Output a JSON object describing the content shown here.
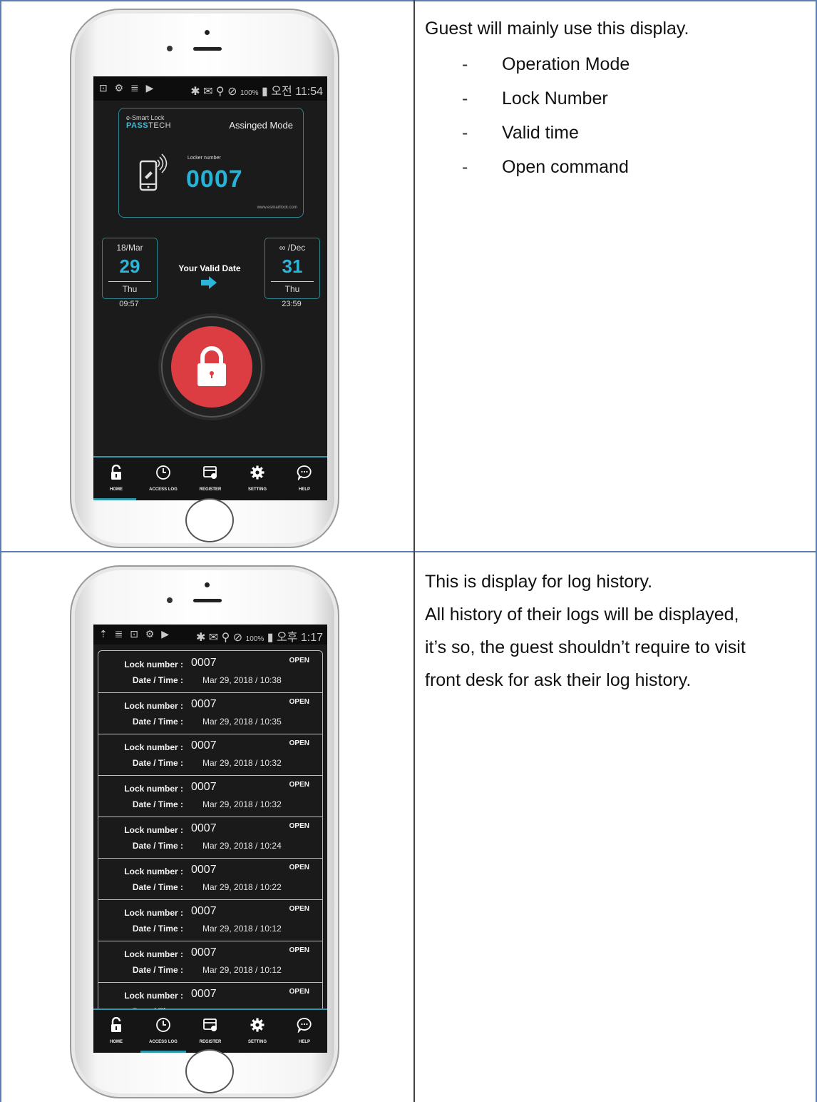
{
  "home_screen": {
    "status_bar": {
      "left_icons": "⊡ ⚙ ≣ ▶",
      "right_icons": "✱ ✉ ⚲ ⊘",
      "battery_pct": "100%",
      "time": "오전 11:54"
    },
    "brand_small": "e-Smart Lock",
    "brand_pass": "PASS",
    "brand_tech": "TECH",
    "mode": "Assinged Mode",
    "locker_label": "Locker number",
    "locker_number": "0007",
    "url": "www.esmartlock.com",
    "valid_label": "Your Valid Date",
    "start": {
      "month": "18/Mar",
      "day": "29",
      "weekday": "Thu",
      "time": "09:57"
    },
    "end": {
      "month": "∞ /Dec",
      "day": "31",
      "weekday": "Thu",
      "time": "23:59"
    }
  },
  "nav": {
    "home": "HOME",
    "access_log": "ACCESS LOG",
    "register": "REGISTER",
    "setting": "SETTING",
    "help": "HELP"
  },
  "desc1": {
    "intro": "Guest will mainly use this display.",
    "dash": "-",
    "items": [
      "Operation Mode",
      "Lock Number",
      "Valid time",
      "Open command"
    ]
  },
  "log_screen": {
    "status_bar": {
      "left_icons": "⇡ ≣ ⊡ ⚙ ▶",
      "right_icons": "✱ ✉ ⚲ ⊘",
      "battery_pct": "100%",
      "time": "오후 1:17"
    },
    "lock_label": "Lock number :",
    "date_label": "Date / Time :",
    "entries": [
      {
        "number": "0007",
        "datetime": "Mar 29, 2018 / 10:38",
        "status": "OPEN"
      },
      {
        "number": "0007",
        "datetime": "Mar 29, 2018 / 10:35",
        "status": "OPEN"
      },
      {
        "number": "0007",
        "datetime": "Mar 29, 2018 / 10:32",
        "status": "OPEN"
      },
      {
        "number": "0007",
        "datetime": "Mar 29, 2018 / 10:32",
        "status": "OPEN"
      },
      {
        "number": "0007",
        "datetime": "Mar 29, 2018 / 10:24",
        "status": "OPEN"
      },
      {
        "number": "0007",
        "datetime": "Mar 29, 2018 / 10:22",
        "status": "OPEN"
      },
      {
        "number": "0007",
        "datetime": "Mar 29, 2018 / 10:12",
        "status": "OPEN"
      },
      {
        "number": "0007",
        "datetime": "Mar 29, 2018 / 10:12",
        "status": "OPEN"
      },
      {
        "number": "0007",
        "datetime": "",
        "status": "OPEN"
      }
    ]
  },
  "desc2": {
    "lines": [
      "This is display for log history.",
      "All history of their logs will be displayed,",
      "it’s so, the guest shouldn’t require to visit",
      "front desk for ask their log history."
    ]
  },
  "colors": {
    "accent": "#2bb5d9",
    "lock_button": "#dc3d43",
    "table_border": "#5b7fb2"
  }
}
